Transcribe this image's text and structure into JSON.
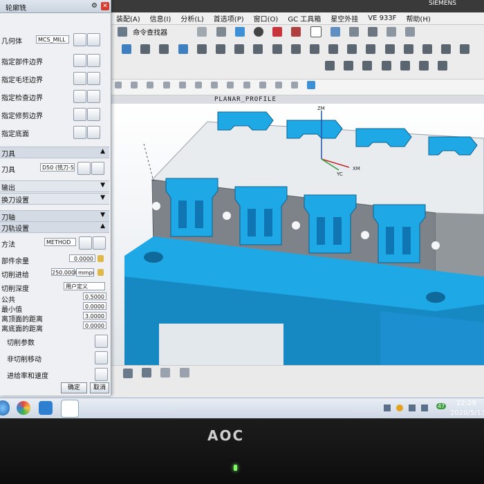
{
  "app": {
    "vendor": "SIEMENS",
    "menus": [
      "装配(A)",
      "信息(I)",
      "分析(L)",
      "首选项(P)",
      "窗口(O)",
      "GC 工具箱",
      "星空外挂",
      "VE 933F",
      "帮助(H)"
    ],
    "command_finder": "命令查找器",
    "operation_label": "PLANAR_PROFILE",
    "axes": {
      "z": "ZM",
      "y": "YC",
      "x": "XM"
    }
  },
  "dialog": {
    "title": "轮廓铣",
    "geometry": {
      "label": "几何体",
      "value": "MCS_MILL",
      "rows": [
        "指定部件边界",
        "指定毛坯边界",
        "指定检查边界",
        "指定修剪边界",
        "指定底面"
      ]
    },
    "tool": {
      "section": "刀具",
      "label": "刀具",
      "value": "D50 (铣刀-5)",
      "output": "输出",
      "change": "换刀设置"
    },
    "axis": {
      "section": "刀轴"
    },
    "path": {
      "section": "刀轨设置",
      "method_label": "方法",
      "method_value": "METHOD",
      "fields": [
        {
          "label": "部件余量",
          "value": "0.0000"
        },
        {
          "label": "切削进给",
          "value": "250.0000",
          "unit": "mmpm"
        },
        {
          "label": "切削深度",
          "value": "用户定义"
        },
        {
          "label": "公共",
          "value": "0.5000"
        },
        {
          "label": "最小值",
          "value": "0.0000"
        },
        {
          "label": "离顶面的距离",
          "value": "3.0000"
        },
        {
          "label": "离底面的距离",
          "value": "0.0000"
        }
      ],
      "cut_params": "切削参数",
      "non_cut": "非切削移动",
      "feeds": "进给率和速度"
    },
    "ok": "确定",
    "cancel": "取消"
  },
  "taskbar": {
    "time": "22:29",
    "date": "2020/5/13",
    "volume_badge": "47"
  },
  "monitor": {
    "brand": "AOC"
  },
  "colors": {
    "part_blue": "#1ea9e6",
    "fixture_gray": "#7d8288",
    "clamp_blue": "#2a8fd8"
  }
}
